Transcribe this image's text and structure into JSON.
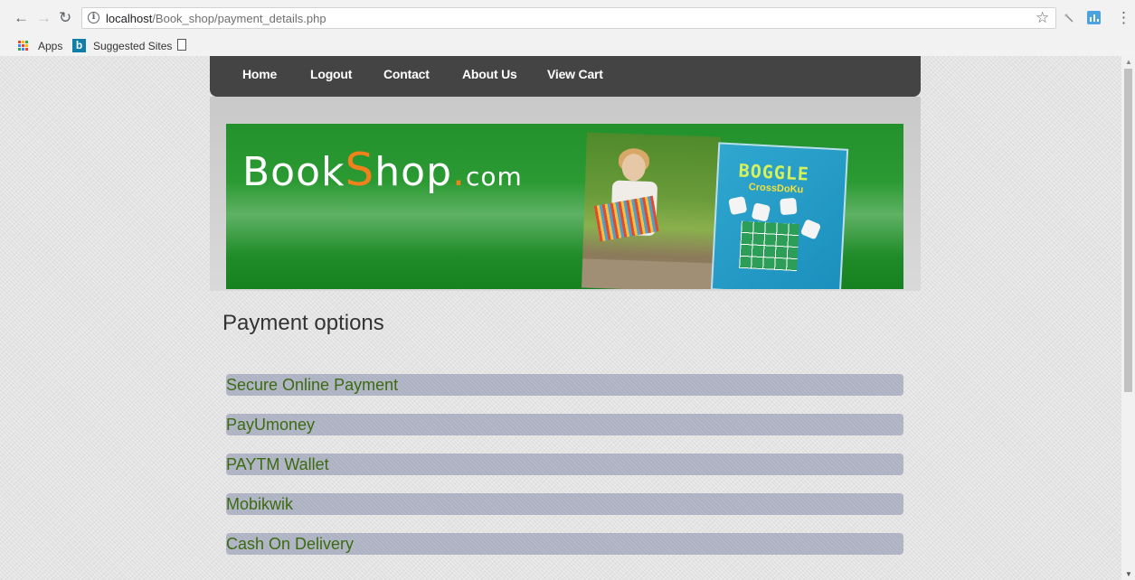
{
  "browser": {
    "url_host": "localhost",
    "url_path": "/Book_shop/payment_details.php",
    "bookmarks": {
      "apps_label": "Apps",
      "suggested_label": "Suggested Sites"
    }
  },
  "nav": {
    "items": [
      {
        "label": "Home"
      },
      {
        "label": "Logout"
      },
      {
        "label": "Contact"
      },
      {
        "label": "About Us"
      },
      {
        "label": "View Cart"
      }
    ]
  },
  "banner": {
    "logo_part1": "Book",
    "logo_s": "S",
    "logo_part2": "hop",
    "logo_dot": ".",
    "logo_com": "com",
    "box_title": "BOGGLE",
    "box_subtitle": "CrossDoKu"
  },
  "main": {
    "title": "Payment options",
    "options": [
      {
        "label": "Secure Online Payment"
      },
      {
        "label": "PayUmoney"
      },
      {
        "label": "PAYTM Wallet"
      },
      {
        "label": "Mobikwik"
      },
      {
        "label": "Cash On Delivery"
      }
    ]
  },
  "colors": {
    "navbar": "#444444",
    "banner_green": "#23912c",
    "logo_accent": "#f2811b",
    "option_bg": "#adb2c3",
    "option_text": "#3c6b0f"
  }
}
